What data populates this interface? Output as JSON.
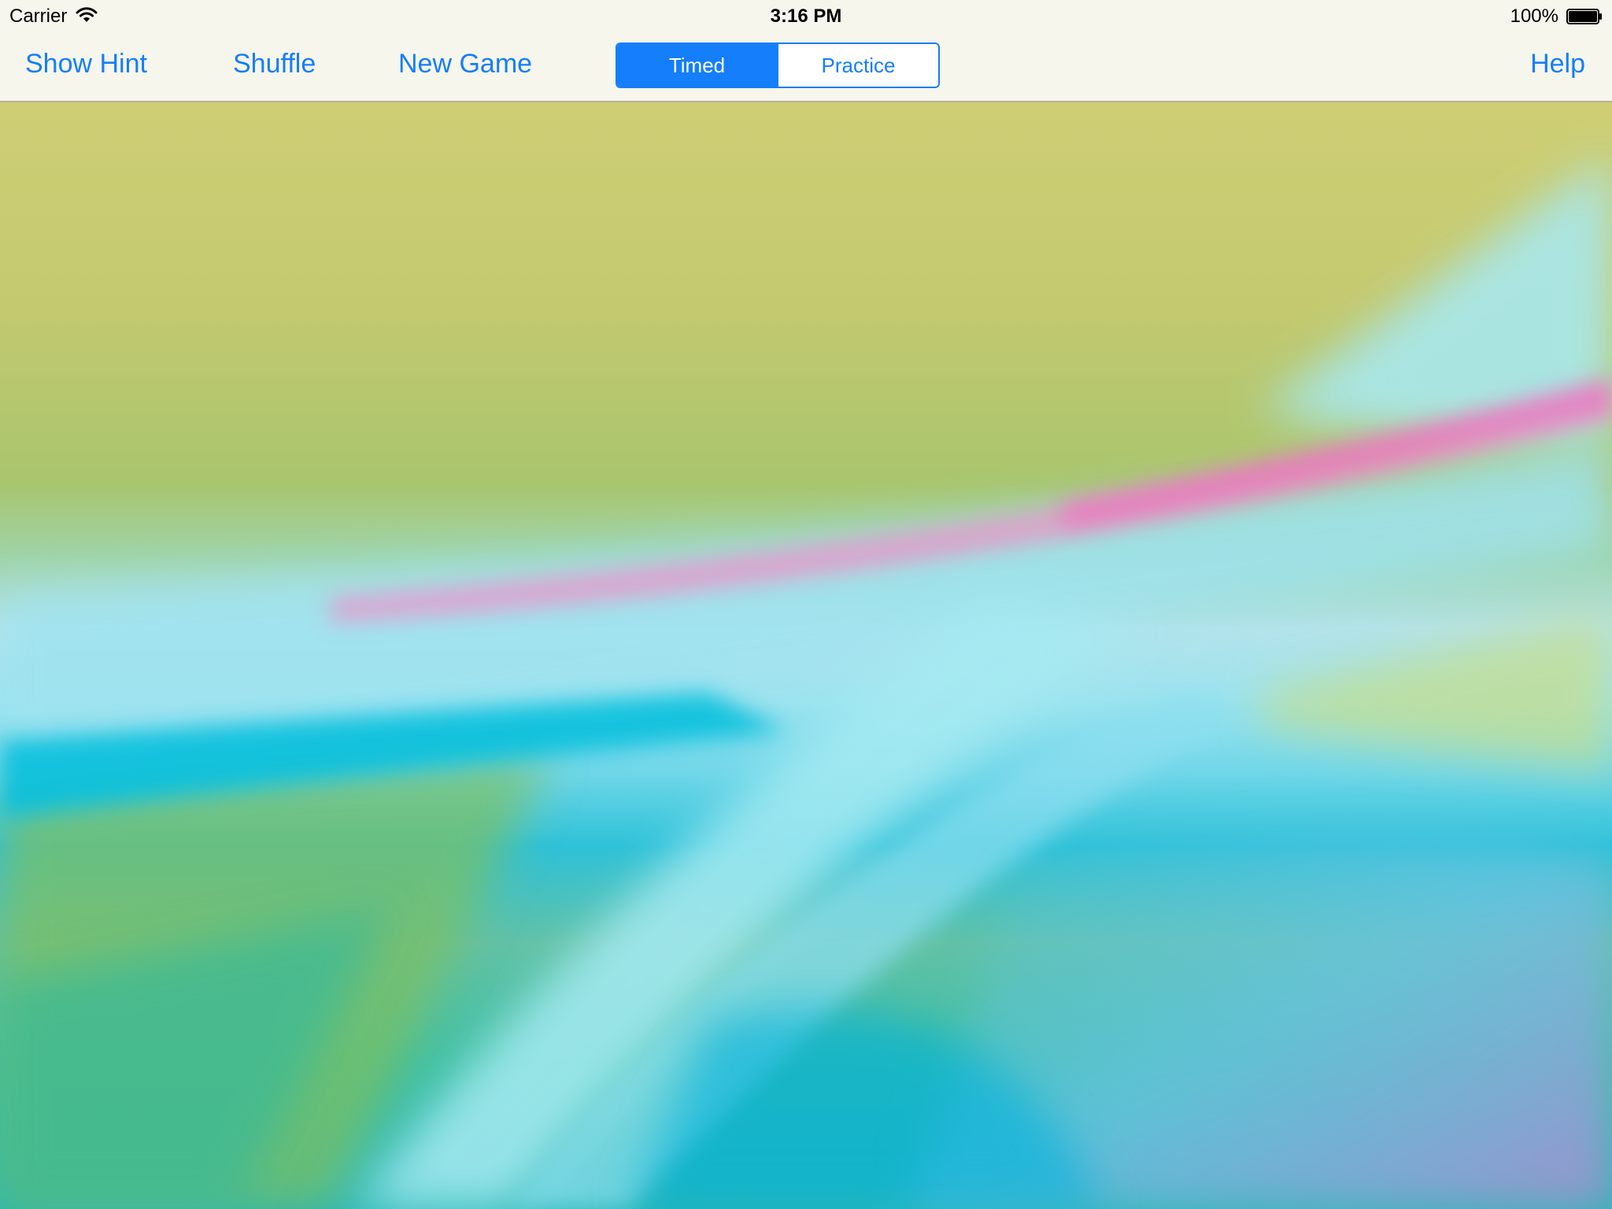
{
  "status_bar": {
    "carrier": "Carrier",
    "wifi_icon": "wifi-icon",
    "time": "3:16 PM",
    "battery_percent": "100%",
    "battery_icon": "battery-full-icon"
  },
  "toolbar": {
    "show_hint": "Show Hint",
    "shuffle": "Shuffle",
    "new_game": "New Game",
    "help": "Help",
    "mode_segment": {
      "options": [
        "Timed",
        "Practice"
      ],
      "selected": "Timed"
    }
  },
  "colors": {
    "accent": "#147efb",
    "toolbar_bg": "#f8f7f0"
  }
}
